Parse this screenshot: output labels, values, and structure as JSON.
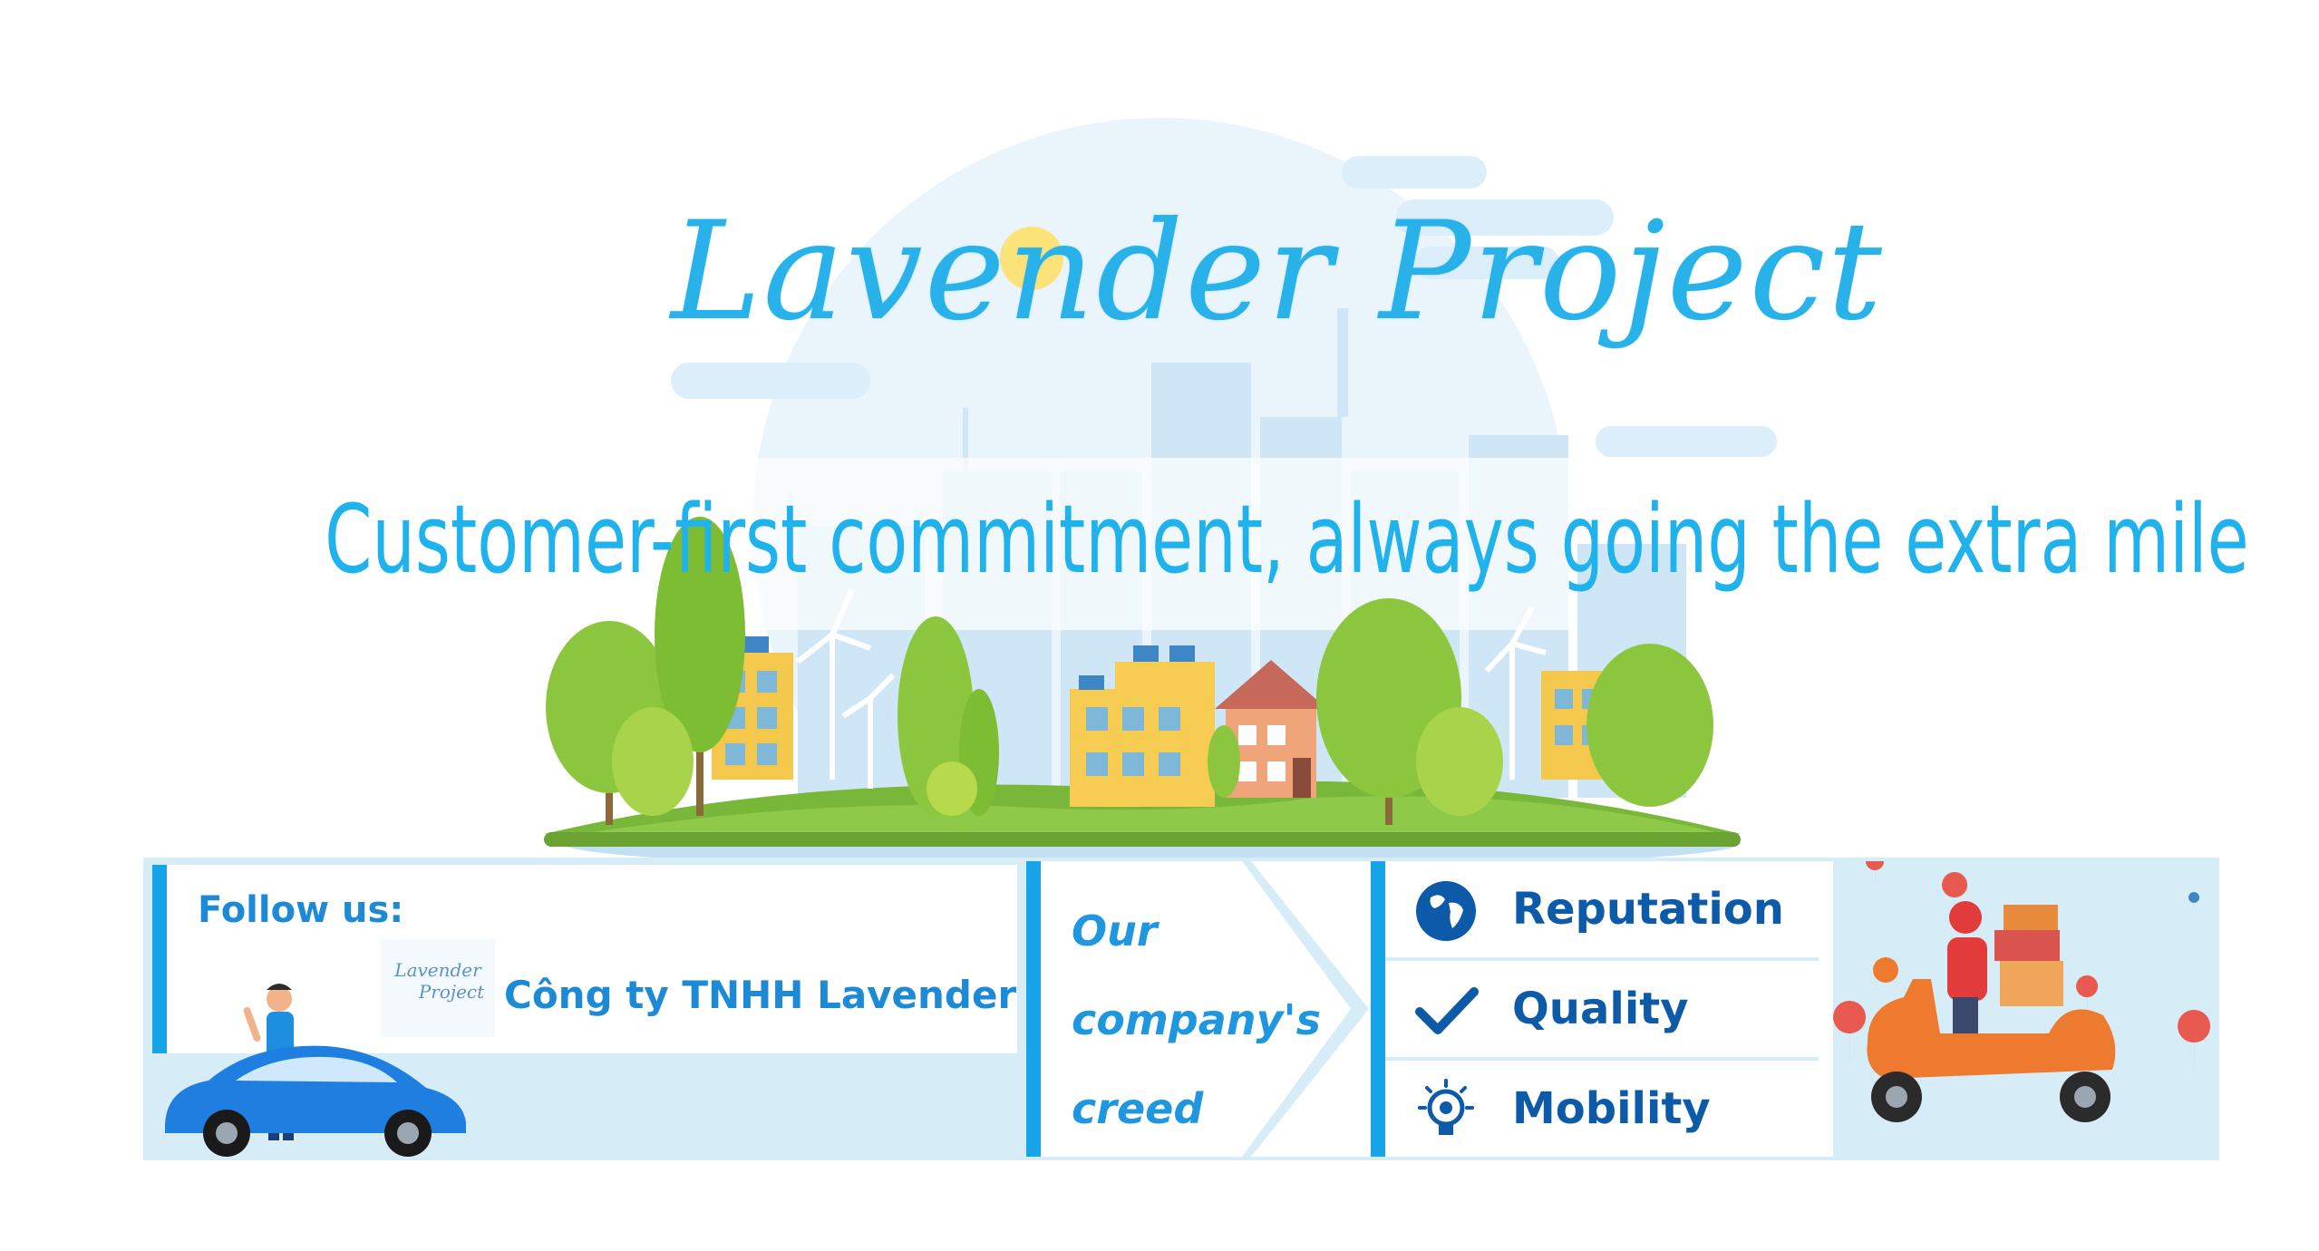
{
  "brand": {
    "title": "Lavender Project",
    "slogan": "Customer-first commitment, always going the extra mile"
  },
  "follow": {
    "label": "Follow us:",
    "logo_line1": "Lavender",
    "logo_line2": "Project",
    "company_name": "Công ty TNHH Lavender"
  },
  "creed": {
    "line1": "Our",
    "line2": "company's",
    "line3": "creed"
  },
  "values": [
    {
      "label": "Reputation",
      "icon": "globe-icon"
    },
    {
      "label": "Quality",
      "icon": "checkmark-icon"
    },
    {
      "label": "Mobility",
      "icon": "lightbulb-gear-icon"
    }
  ],
  "colors": {
    "accent": "#17a4e8",
    "title": "#29b2ea",
    "value_text": "#0d5aa8",
    "strip_bg": "#d6edf8"
  }
}
